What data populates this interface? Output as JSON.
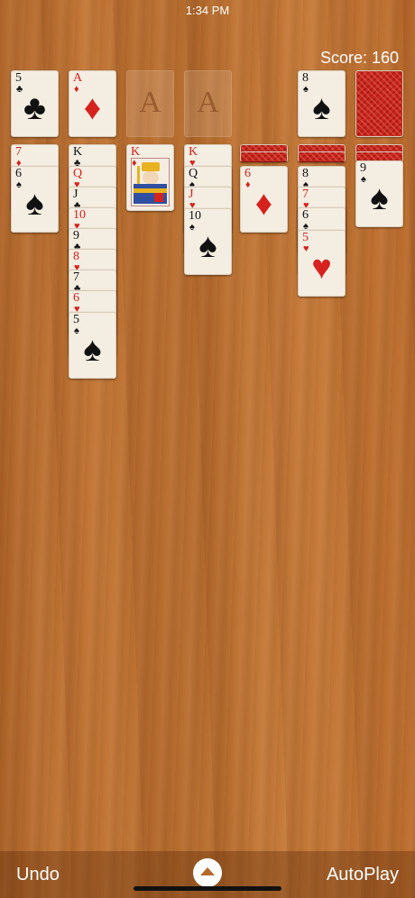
{
  "status_bar": {
    "time": "1:34 PM"
  },
  "score": {
    "label": "Score: 160"
  },
  "top_row": {
    "waste_card": {
      "rank": "5",
      "suit": "♣",
      "color": "black"
    },
    "foundations": [
      {
        "rank": "A",
        "suit": "♦",
        "color": "red",
        "empty": false
      },
      {
        "placeholder": "A",
        "empty": true
      },
      {
        "placeholder": "A",
        "empty": true
      }
    ],
    "discard_card": {
      "rank": "8",
      "suit": "♠",
      "color": "black"
    },
    "stock": {
      "face_down": true
    }
  },
  "tableau": [
    {
      "cards": [
        {
          "rank": "7",
          "suit": "♦",
          "color": "red"
        },
        {
          "rank": "6",
          "suit": "♠",
          "color": "black"
        }
      ]
    },
    {
      "cards": [
        {
          "rank": "K",
          "suit": "♣",
          "color": "black"
        },
        {
          "rank": "Q",
          "suit": "♥",
          "color": "red"
        },
        {
          "rank": "J",
          "suit": "♣",
          "color": "black"
        },
        {
          "rank": "10",
          "suit": "♥",
          "color": "red"
        },
        {
          "rank": "9",
          "suit": "♣",
          "color": "black"
        },
        {
          "rank": "8",
          "suit": "♥",
          "color": "red"
        },
        {
          "rank": "7",
          "suit": "♣",
          "color": "black"
        },
        {
          "rank": "6",
          "suit": "♥",
          "color": "red"
        },
        {
          "rank": "5",
          "suit": "♠",
          "color": "black"
        }
      ]
    },
    {
      "cards": [
        {
          "rank": "K",
          "suit": "♦",
          "color": "red"
        }
      ]
    },
    {
      "cards": [
        {
          "rank": "K",
          "suit": "♥",
          "color": "red"
        },
        {
          "rank": "Q",
          "suit": "♠",
          "color": "black"
        },
        {
          "rank": "J",
          "suit": "♥",
          "color": "red"
        },
        {
          "rank": "10",
          "suit": "♠",
          "color": "black"
        }
      ]
    },
    {
      "face_down_count": 1,
      "cards": [
        {
          "rank": "6",
          "suit": "♦",
          "color": "red"
        }
      ]
    },
    {
      "face_down_count": 1,
      "cards": [
        {
          "rank": "8",
          "suit": "♠",
          "color": "black"
        },
        {
          "rank": "7",
          "suit": "♥",
          "color": "red"
        },
        {
          "rank": "6",
          "suit": "♠",
          "color": "black"
        },
        {
          "rank": "5",
          "suit": "♥",
          "color": "red"
        }
      ]
    },
    {
      "face_down_count": 1,
      "cards": [
        {
          "rank": "9",
          "suit": "♠",
          "color": "black"
        }
      ]
    }
  ],
  "toolbar": {
    "undo_label": "Undo",
    "autoplay_label": "AutoPlay"
  },
  "colors": {
    "table": "#b8692b",
    "red_suit": "#d6221e",
    "card_face": "#f4ede2",
    "card_back": "#c6281f"
  }
}
